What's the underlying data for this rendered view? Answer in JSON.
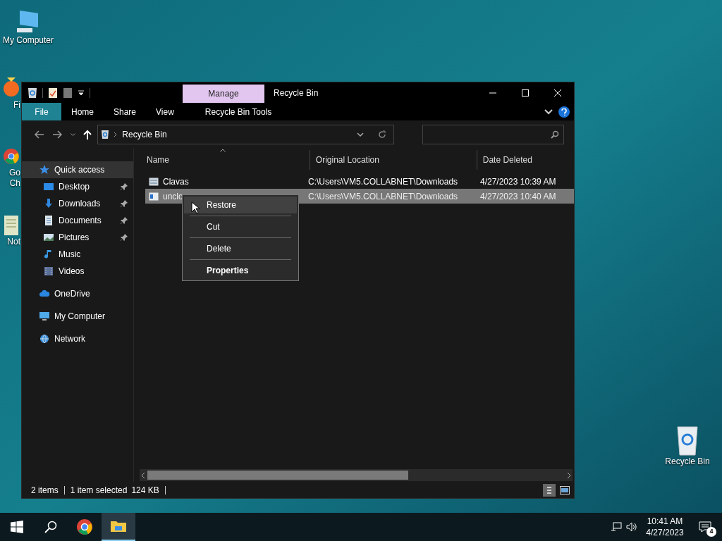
{
  "desktop_icons": [
    {
      "kind": "computer",
      "label_lines": [
        "My Computer"
      ]
    },
    {
      "kind": "recycle",
      "label_lines": [
        "Recycle Bin"
      ]
    }
  ],
  "covered_icons": [
    {
      "kind": "firefox",
      "label_lines": [
        "Fi"
      ]
    },
    {
      "kind": "chrome",
      "label_lines": [
        "Go",
        "Ch"
      ]
    },
    {
      "kind": "notepad",
      "label_lines": [
        "Not"
      ]
    }
  ],
  "window": {
    "title": "Recycle Bin",
    "context_tab": "Manage",
    "ribbon_tabs": [
      {
        "label": "File",
        "kind": "file",
        "selected": false
      },
      {
        "label": "Home",
        "kind": "tab",
        "selected": false
      },
      {
        "label": "Share",
        "kind": "tab",
        "selected": false
      },
      {
        "label": "View",
        "kind": "tab",
        "selected": false
      },
      {
        "label": "Recycle Bin Tools",
        "kind": "context",
        "selected": false
      }
    ],
    "address": {
      "path": [
        "Recycle Bin"
      ]
    },
    "nav": [
      {
        "label": "Quick access",
        "kind": "star",
        "selected": true,
        "children": [
          {
            "label": "Desktop",
            "kind": "desktop",
            "pinned": true
          },
          {
            "label": "Downloads",
            "kind": "download",
            "pinned": true
          },
          {
            "label": "Documents",
            "kind": "document",
            "pinned": true
          },
          {
            "label": "Pictures",
            "kind": "picture",
            "pinned": true
          },
          {
            "label": "Music",
            "kind": "music",
            "pinned": false
          },
          {
            "label": "Videos",
            "kind": "video",
            "pinned": false
          }
        ]
      },
      {
        "label": "OneDrive",
        "kind": "cloud",
        "selected": false
      },
      {
        "label": "My Computer",
        "kind": "computer",
        "selected": false
      },
      {
        "label": "Network",
        "kind": "network",
        "selected": false
      }
    ],
    "columns": [
      {
        "label": "Name",
        "sorted": true
      },
      {
        "label": "Original Location",
        "sorted": false
      },
      {
        "label": "Date Deleted",
        "sorted": false
      }
    ],
    "rows": [
      {
        "name": "Clavas",
        "location": "C:\\Users\\VM5.COLLABNET\\Downloads",
        "date": "4/27/2023 10:39 AM",
        "selected": false
      },
      {
        "name": "unclo",
        "location": "C:\\Users\\VM5.COLLABNET\\Downloads",
        "date": "4/27/2023 10:40 AM",
        "selected": true
      }
    ],
    "context_menu": [
      {
        "label": "Restore",
        "default": false,
        "selected": true
      },
      {
        "label": "Cut",
        "default": false,
        "selected": false
      },
      {
        "label": "Delete",
        "default": false,
        "selected": false
      },
      {
        "label": "Properties",
        "default": true,
        "selected": false
      }
    ],
    "status_bar": [
      "2 items",
      "1 item selected",
      "124 KB"
    ]
  },
  "taskbar": {
    "apps": [
      {
        "kind": "chrome",
        "active": false
      },
      {
        "kind": "explorer",
        "active": true
      }
    ],
    "time": "10:41 AM",
    "date": "4/27/2023",
    "notifications": "4"
  }
}
